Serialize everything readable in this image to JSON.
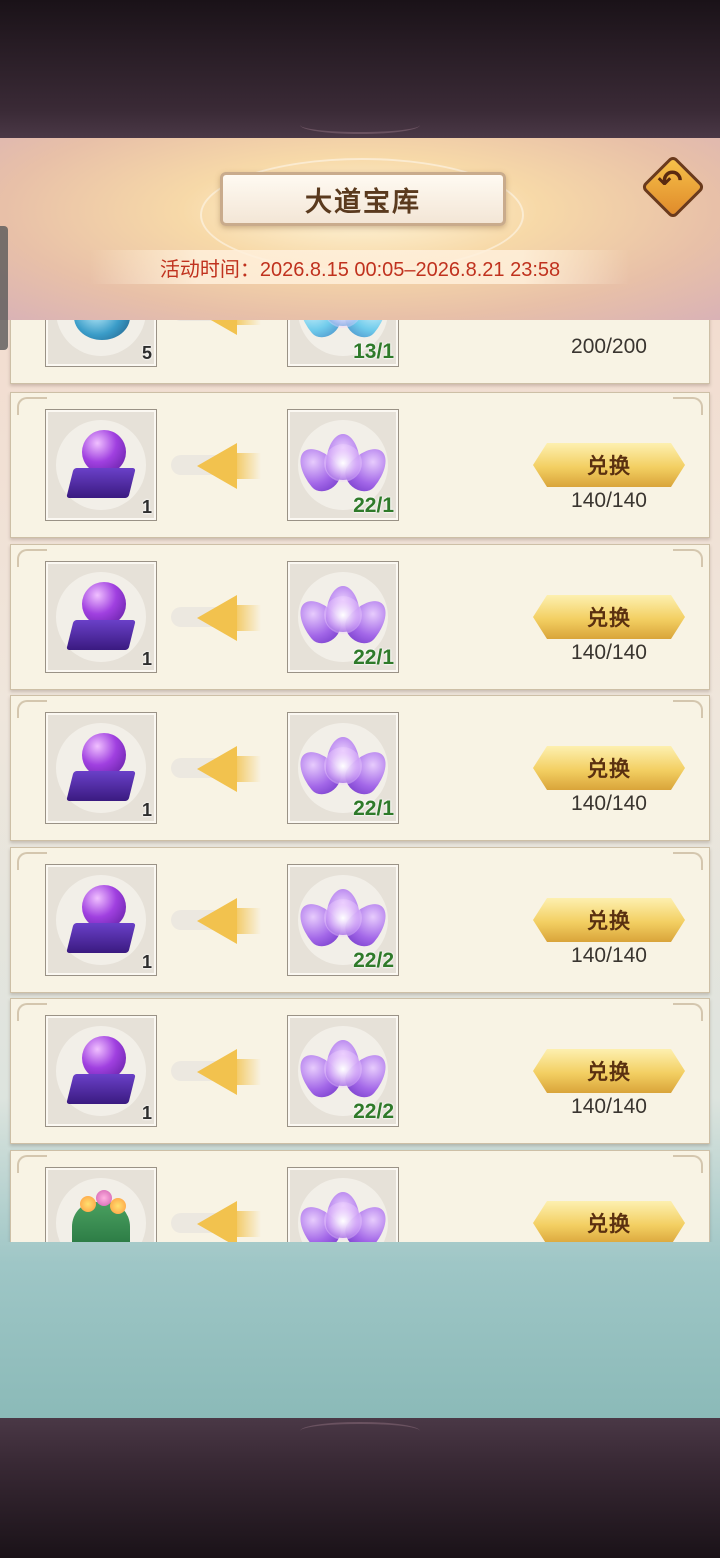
{
  "header": {
    "title": "大道宝库",
    "event_time": "活动时间：2026.8.15 00:05–2026.8.21 23:58",
    "back_glyph": "↶"
  },
  "rows": [
    {
      "reward_icon": "blue-bead-icon",
      "reward_count": "5",
      "cost_icon": "blue-lotus-icon",
      "cost_count": "13/1",
      "button": "",
      "limit": "200/200"
    },
    {
      "reward_icon": "purple-orb-pedestal-icon",
      "reward_count": "1",
      "cost_icon": "purple-lotus-icon",
      "cost_count": "22/1",
      "button": "兑换",
      "limit": "140/140"
    },
    {
      "reward_icon": "purple-orb-pedestal-icon",
      "reward_count": "1",
      "cost_icon": "purple-lotus-icon",
      "cost_count": "22/1",
      "button": "兑换",
      "limit": "140/140"
    },
    {
      "reward_icon": "purple-orb-pedestal-icon",
      "reward_count": "1",
      "cost_icon": "purple-lotus-icon",
      "cost_count": "22/1",
      "button": "兑换",
      "limit": "140/140"
    },
    {
      "reward_icon": "purple-orb-pedestal-icon",
      "reward_count": "1",
      "cost_icon": "purple-lotus-icon",
      "cost_count": "22/2",
      "button": "兑换",
      "limit": "140/140"
    },
    {
      "reward_icon": "purple-orb-pedestal-icon",
      "reward_count": "1",
      "cost_icon": "purple-lotus-icon",
      "cost_count": "22/2",
      "button": "兑换",
      "limit": "140/140"
    },
    {
      "reward_icon": "green-plant-icon",
      "reward_count": "",
      "cost_icon": "purple-lotus-icon",
      "cost_count": "",
      "button": "兑换",
      "limit": ""
    }
  ]
}
